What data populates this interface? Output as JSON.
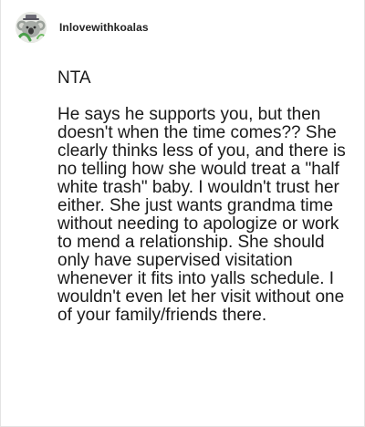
{
  "post": {
    "username": "Inlovewithkoalas",
    "avatar_icon": "koala-avatar-icon",
    "verdict": "NTA",
    "body": "He says he supports you, but then doesn't when the time comes?? She clearly thinks less of you, and there is no telling how she would treat a \"half white trash\" baby. I wouldn't trust her either. She just wants grandma time without needing to apologize or work to mend a relationship. She should only have supervised visitation whenever it fits into yalls schedule. I wouldn't even let her visit without one of your family/friends there."
  }
}
